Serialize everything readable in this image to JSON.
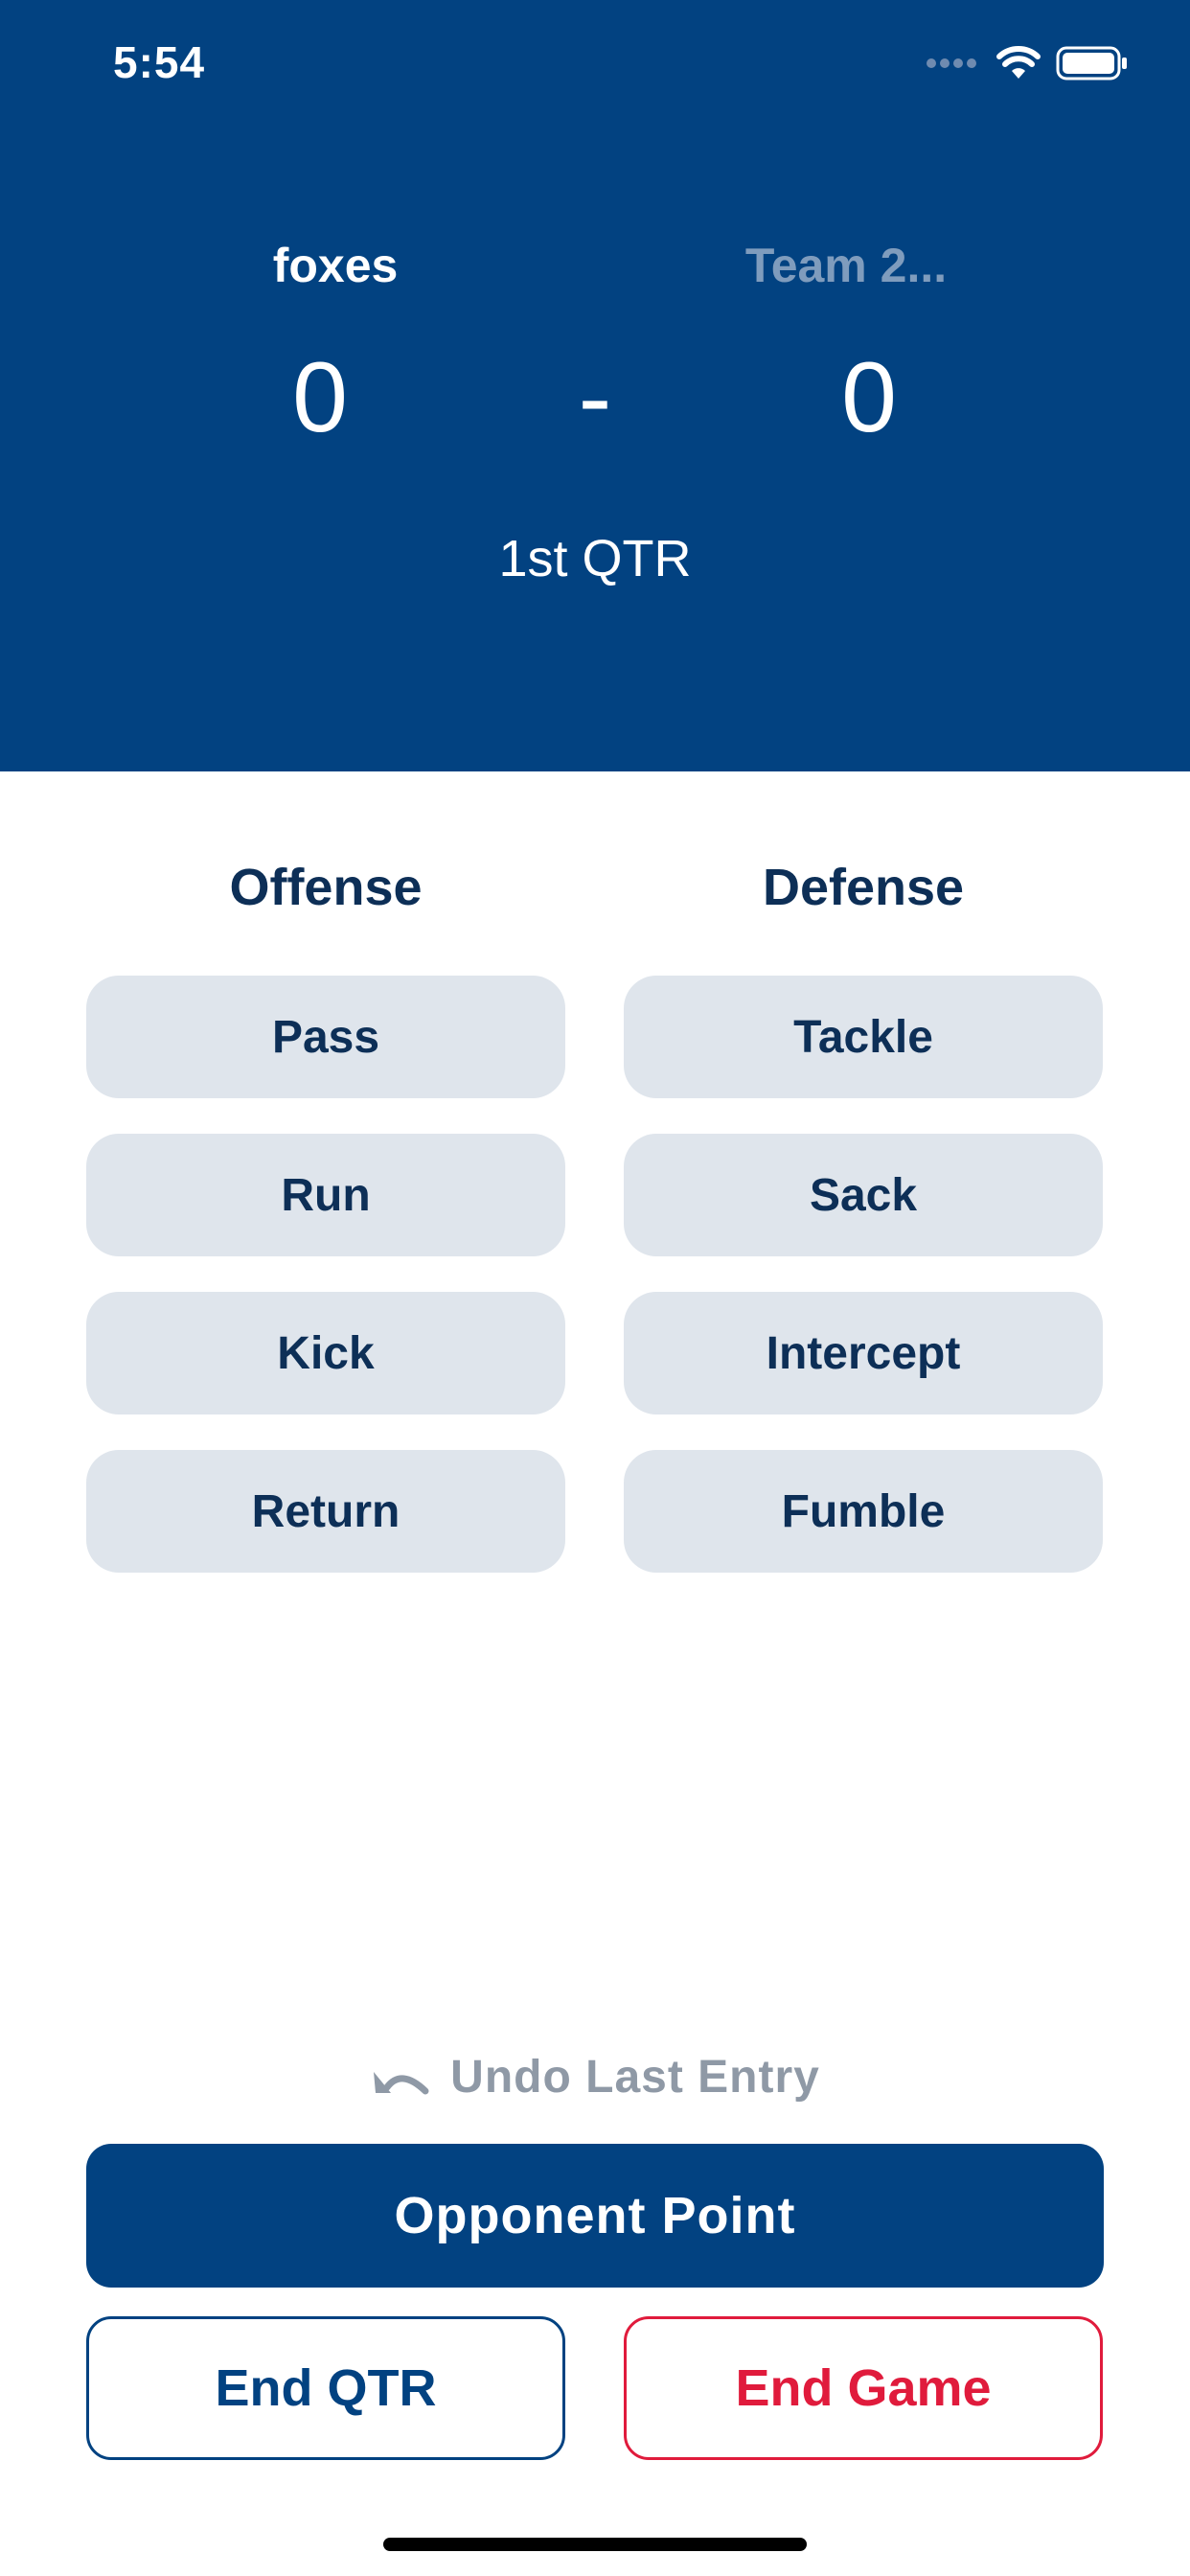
{
  "status_bar": {
    "time": "5:54",
    "icons": [
      "cellular-signal-icon",
      "wifi-icon",
      "battery-icon"
    ]
  },
  "scoreboard": {
    "team1_name": "foxes",
    "team2_name": "Team 2...",
    "team1_score": "0",
    "separator": "-",
    "team2_score": "0",
    "period": "1st QTR"
  },
  "offense": {
    "title": "Offense",
    "actions": [
      "Pass",
      "Run",
      "Kick",
      "Return"
    ]
  },
  "defense": {
    "title": "Defense",
    "actions": [
      "Tackle",
      "Sack",
      "Intercept",
      "Fumble"
    ]
  },
  "controls": {
    "undo_label": "Undo Last Entry",
    "opponent_point_label": "Opponent Point",
    "end_qtr_label": "End QTR",
    "end_game_label": "End Game"
  },
  "colors": {
    "primary": "#024281",
    "danger": "#e01b3c",
    "muted_team": "#7f9cbd",
    "action_bg": "#dfe5ec",
    "action_text": "#0d2f57",
    "undo_text": "#8f99a6"
  }
}
